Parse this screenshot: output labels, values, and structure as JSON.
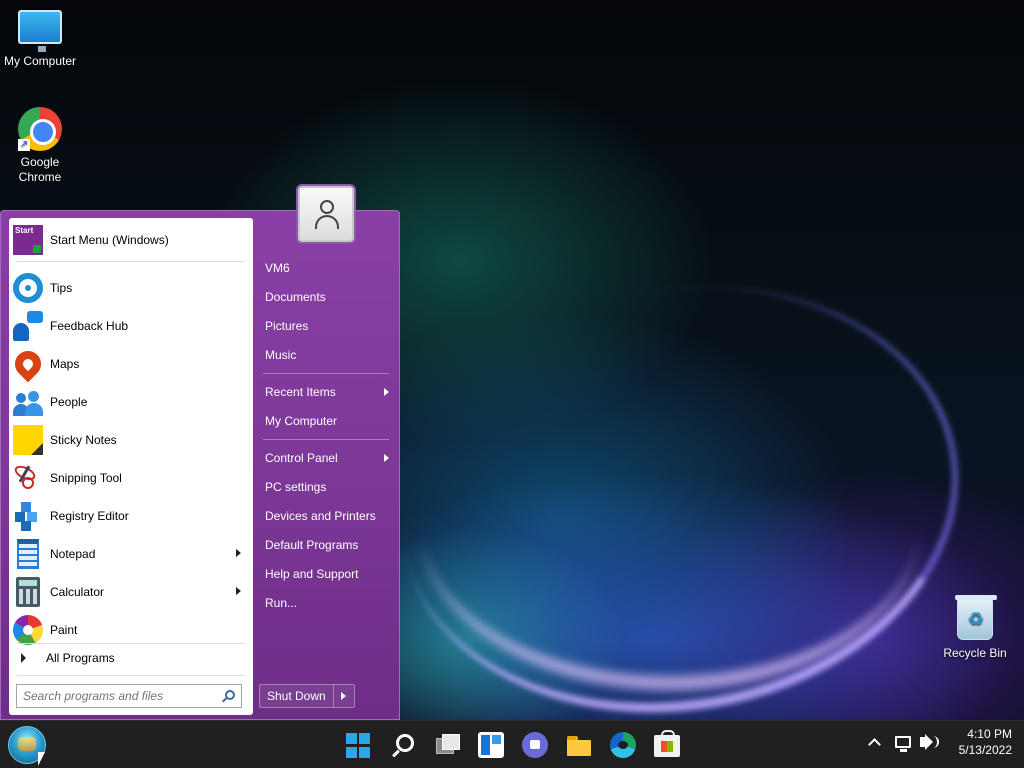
{
  "desktop": {
    "icons": [
      {
        "label": "My Computer",
        "icon": "monitor-icon"
      },
      {
        "label": "Google\nChrome",
        "icon": "chrome-icon"
      },
      {
        "label": "Recycle Bin",
        "icon": "recycle-bin-icon"
      }
    ]
  },
  "start_menu": {
    "theme_color": "#7d3799",
    "pinned_header": {
      "label": "Start Menu (Windows)",
      "icon": "start-menu-app-icon",
      "icon_text": "Start"
    },
    "programs": [
      {
        "label": "Tips",
        "icon": "tips-bulb-icon",
        "submenu": false
      },
      {
        "label": "Feedback Hub",
        "icon": "feedback-hub-icon",
        "submenu": false
      },
      {
        "label": "Maps",
        "icon": "map-pin-icon",
        "submenu": false
      },
      {
        "label": "People",
        "icon": "people-icon",
        "submenu": false
      },
      {
        "label": "Sticky Notes",
        "icon": "sticky-note-icon",
        "submenu": false
      },
      {
        "label": "Snipping Tool",
        "icon": "scissors-icon",
        "submenu": false
      },
      {
        "label": "Registry Editor",
        "icon": "registry-cubes-icon",
        "submenu": false
      },
      {
        "label": "Notepad",
        "icon": "notepad-icon",
        "submenu": true
      },
      {
        "label": "Calculator",
        "icon": "calculator-icon",
        "submenu": true
      },
      {
        "label": "Paint",
        "icon": "paint-palette-icon",
        "submenu": false
      }
    ],
    "all_programs_label": "All Programs",
    "search_placeholder": "Search programs and files",
    "right_items": [
      {
        "label": "VM6",
        "submenu": false
      },
      {
        "label": "Documents",
        "submenu": false
      },
      {
        "label": "Pictures",
        "submenu": false
      },
      {
        "label": "Music",
        "submenu": false
      },
      {
        "label": "Recent Items",
        "submenu": true
      },
      {
        "label": "My Computer",
        "submenu": false
      },
      {
        "label": "Control Panel",
        "submenu": true
      },
      {
        "label": "PC settings",
        "submenu": false
      },
      {
        "label": "Devices and Printers",
        "submenu": false
      },
      {
        "label": "Default Programs",
        "submenu": false
      },
      {
        "label": "Help and Support",
        "submenu": false
      },
      {
        "label": "Run...",
        "submenu": false
      }
    ],
    "shutdown_label": "Shut Down"
  },
  "taskbar": {
    "pinned": [
      "windows-logo-icon",
      "search-icon",
      "task-view-icon",
      "widgets-icon",
      "chat-icon",
      "file-explorer-icon",
      "edge-icon",
      "store-icon"
    ],
    "tray": [
      "chevron-up-icon",
      "network-icon",
      "volume-icon"
    ],
    "time": "4:10 PM",
    "date": "5/13/2022"
  }
}
